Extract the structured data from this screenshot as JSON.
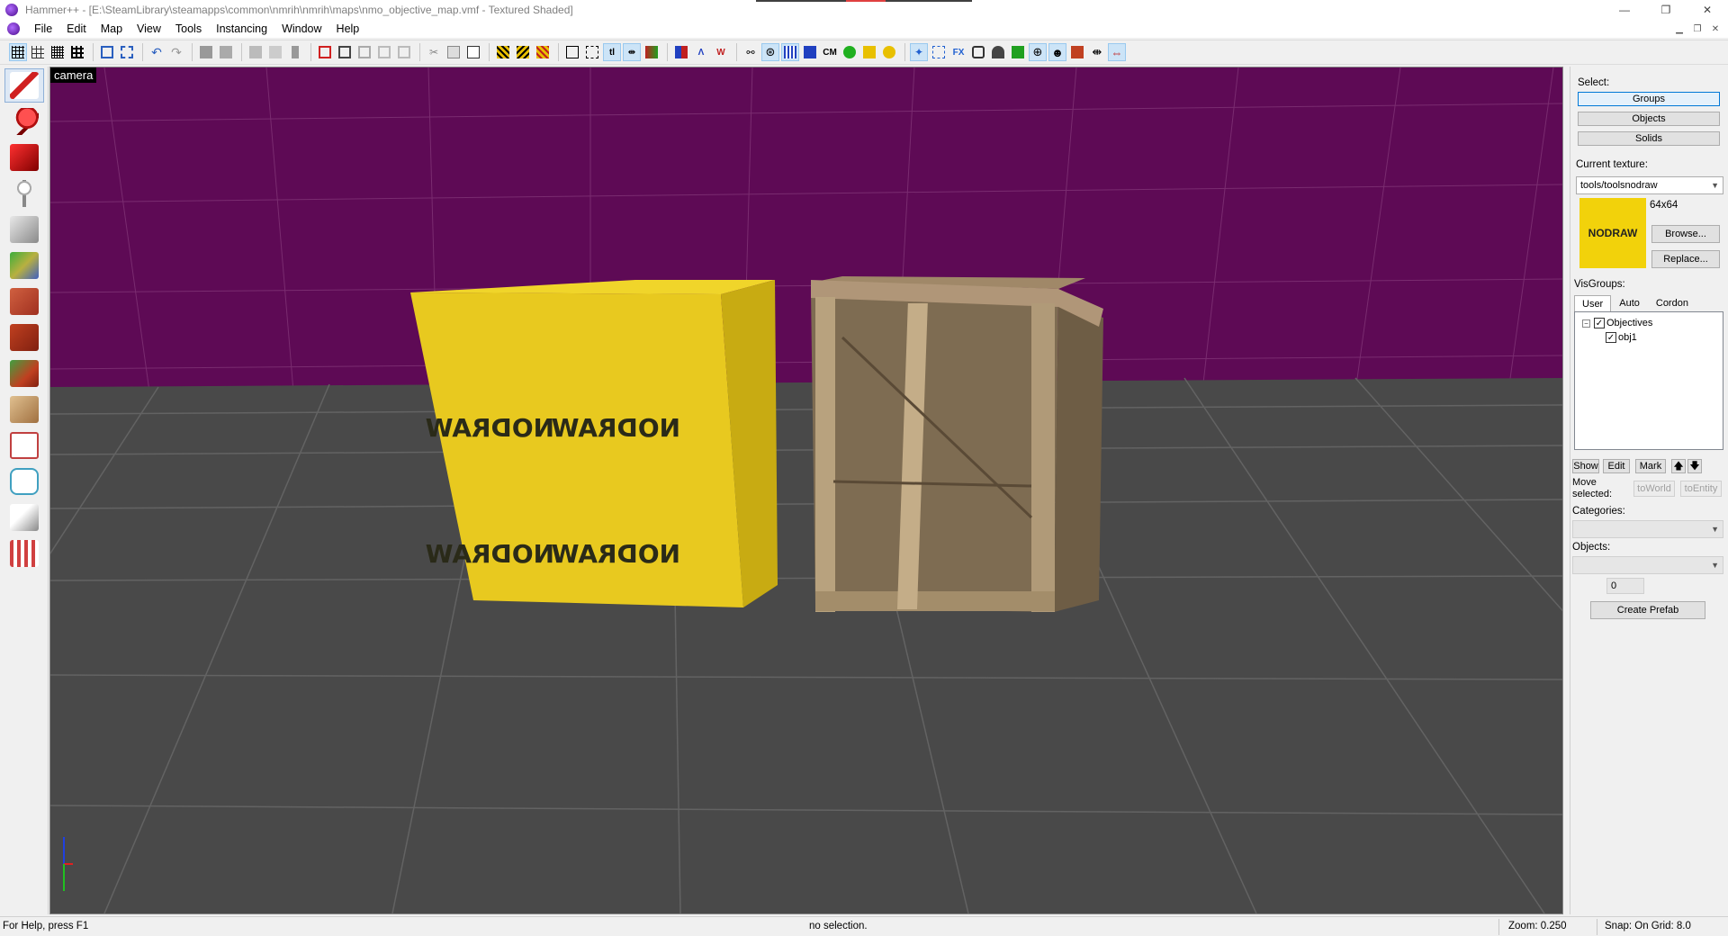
{
  "window": {
    "title": "Hammer++ - [E:\\SteamLibrary\\steamapps\\common\\nmrih\\nmrih\\maps\\nmo_objective_map.vmf - Textured Shaded]",
    "minimize": "—",
    "restore": "❐",
    "close": "✕"
  },
  "menu": {
    "items": [
      "File",
      "Edit",
      "Map",
      "View",
      "Tools",
      "Instancing",
      "Window",
      "Help"
    ]
  },
  "toolbar": {
    "cm_label": "CM"
  },
  "viewport": {
    "label": "camera",
    "sky_color": "#5e0a55",
    "floor_color": "#494949",
    "crate_left_texture": "NODRAW",
    "nodraw_yellow": "#e8c91f"
  },
  "panel": {
    "select_label": "Select:",
    "groups": "Groups",
    "objects": "Objects",
    "solids": "Solids",
    "current_texture_label": "Current texture:",
    "current_texture": "tools/toolsnodraw",
    "texture_size": "64x64",
    "texture_preview_text": "NODRAW",
    "browse": "Browse...",
    "replace": "Replace...",
    "visgroups_label": "VisGroups:",
    "tabs": [
      "User",
      "Auto",
      "Cordon"
    ],
    "visgroups": [
      {
        "name": "Objectives",
        "checked": true
      },
      {
        "name": "obj1",
        "checked": true
      }
    ],
    "show": "Show",
    "edit": "Edit",
    "mark": "Mark",
    "up_arrow": "🡅",
    "down_arrow": "🡇",
    "move_selected_1": "Move",
    "move_selected_2": "selected:",
    "to_world": "toWorld",
    "to_entity": "toEntity",
    "categories_label": "Categories:",
    "objects_label": "Objects:",
    "spin_value": "0",
    "create_prefab": "Create Prefab"
  },
  "status": {
    "help": "For Help, press F1",
    "selection": "no selection.",
    "zoom": "Zoom: 0.250",
    "snap": "Snap: On Grid: 8.0"
  }
}
